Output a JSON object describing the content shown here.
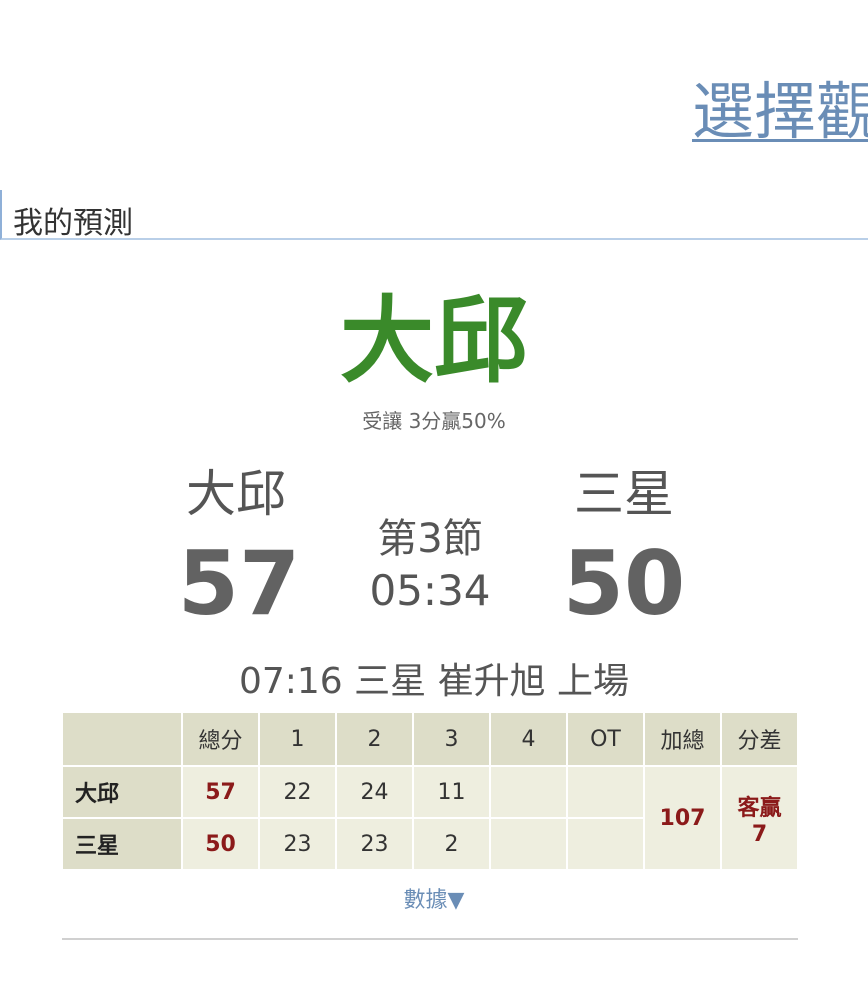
{
  "header": {
    "select_link": "選擇觀",
    "section_title": "我的預測"
  },
  "prediction": {
    "team": "大邱",
    "detail": "受讓 3分贏50%"
  },
  "game": {
    "home": {
      "name": "大邱",
      "score": "57"
    },
    "away": {
      "name": "三星",
      "score": "50"
    },
    "period": "第3節",
    "clock": "05:34",
    "live_event": "07:16 三星 崔升旭 上場"
  },
  "boxscore": {
    "headers": [
      "",
      "總分",
      "1",
      "2",
      "3",
      "4",
      "OT",
      "加總",
      "分差"
    ],
    "rows": [
      {
        "team": "大邱",
        "total": "57",
        "q1": "22",
        "q2": "24",
        "q3": "11",
        "q4": "",
        "ot": ""
      },
      {
        "team": "三星",
        "total": "50",
        "q1": "23",
        "q2": "23",
        "q3": "2",
        "q4": "",
        "ot": ""
      }
    ],
    "sum": "107",
    "diff_line1": "客贏",
    "diff_line2": "7"
  },
  "footer": {
    "data_toggle": "數據▼"
  }
}
